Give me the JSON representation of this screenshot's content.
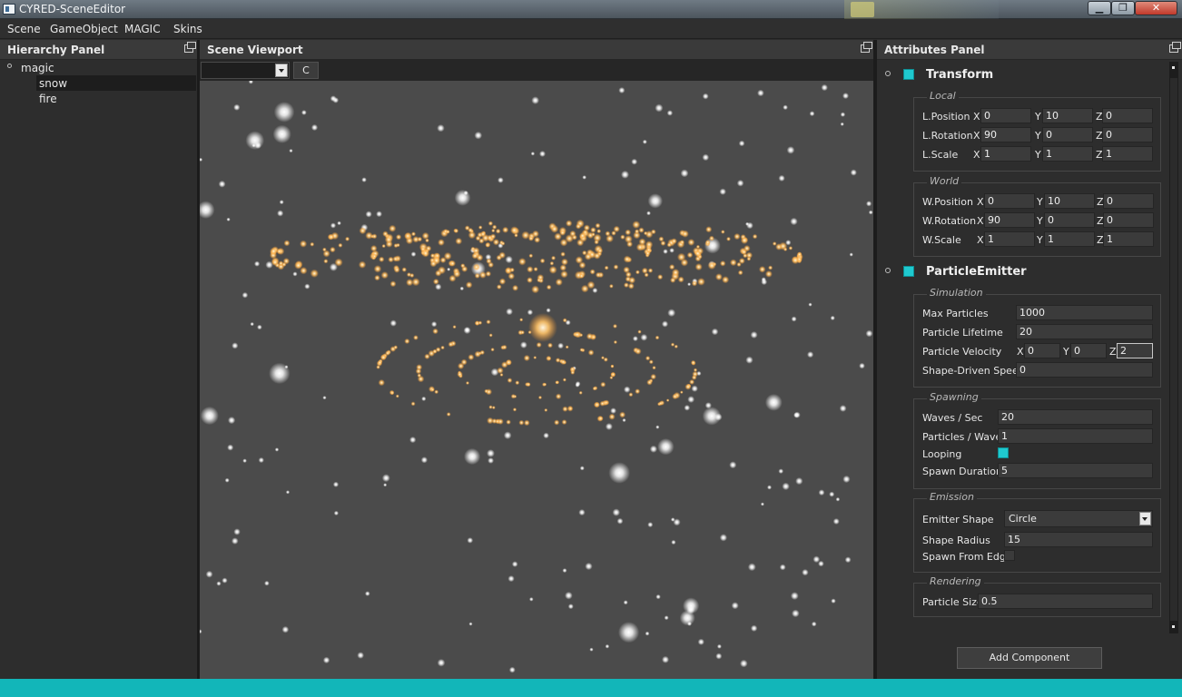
{
  "window": {
    "title": "CYRED-SceneEditor"
  },
  "menu": [
    "Scene",
    "GameObject",
    "MAGIC",
    "Skins"
  ],
  "hierarchy": {
    "title": "Hierarchy Panel",
    "root": "magic",
    "children": [
      "snow",
      "fire"
    ],
    "selected": "snow"
  },
  "viewport": {
    "title": "Scene Viewport",
    "camera_select_value": "",
    "c_button": "C",
    "background": "#4b4b4b"
  },
  "attributes": {
    "title": "Attributes Panel",
    "transform": {
      "title": "Transform",
      "local_group": "Local",
      "world_group": "World",
      "local": [
        {
          "label": "L.Position",
          "x": "0",
          "y": "10",
          "z": "0"
        },
        {
          "label": "L.Rotation",
          "x": "90",
          "y": "0",
          "z": "0"
        },
        {
          "label": "L.Scale",
          "x": "1",
          "y": "1",
          "z": "1"
        }
      ],
      "world": [
        {
          "label": "W.Position",
          "x": "0",
          "y": "10",
          "z": "0"
        },
        {
          "label": "W.Rotation",
          "x": "90",
          "y": "0",
          "z": "0"
        },
        {
          "label": "W.Scale",
          "x": "1",
          "y": "1",
          "z": "1"
        }
      ]
    },
    "particle_emitter": {
      "title": "ParticleEmitter",
      "simulation": {
        "group": "Simulation",
        "max_particles_label": "Max Particles",
        "max_particles": "1000",
        "lifetime_label": "Particle Lifetime",
        "lifetime": "20",
        "velocity_label": "Particle Velocity",
        "velocity_x": "0",
        "velocity_y": "0",
        "velocity_z": "2",
        "shape_speed_label": "Shape-Driven Speed",
        "shape_speed": "0"
      },
      "spawning": {
        "group": "Spawning",
        "waves_label": "Waves / Sec",
        "waves": "20",
        "particles_wave_label": "Particles / Wave",
        "particles_wave": "1",
        "looping_label": "Looping",
        "looping": true,
        "spawn_duration_label": "Spawn Duration",
        "spawn_duration": "5"
      },
      "emission": {
        "group": "Emission",
        "shape_label": "Emitter Shape",
        "shape": "Circle",
        "radius_label": "Shape Radius",
        "radius": "15",
        "from_edge_label": "Spawn From Edge",
        "from_edge": false
      },
      "rendering": {
        "group": "Rendering",
        "size_label": "Particle Size",
        "size": "0.5"
      }
    },
    "add_component": "Add Component"
  },
  "colors": {
    "accent": "#1fc9cf",
    "panel": "#2d2d2d",
    "taskbar": "#12b6b9"
  },
  "icons": [
    "app-icon",
    "minimize-icon",
    "maximize-icon",
    "close-icon",
    "float-panel-icon",
    "collapse-toggle-icon",
    "dropdown-arrow-icon"
  ]
}
